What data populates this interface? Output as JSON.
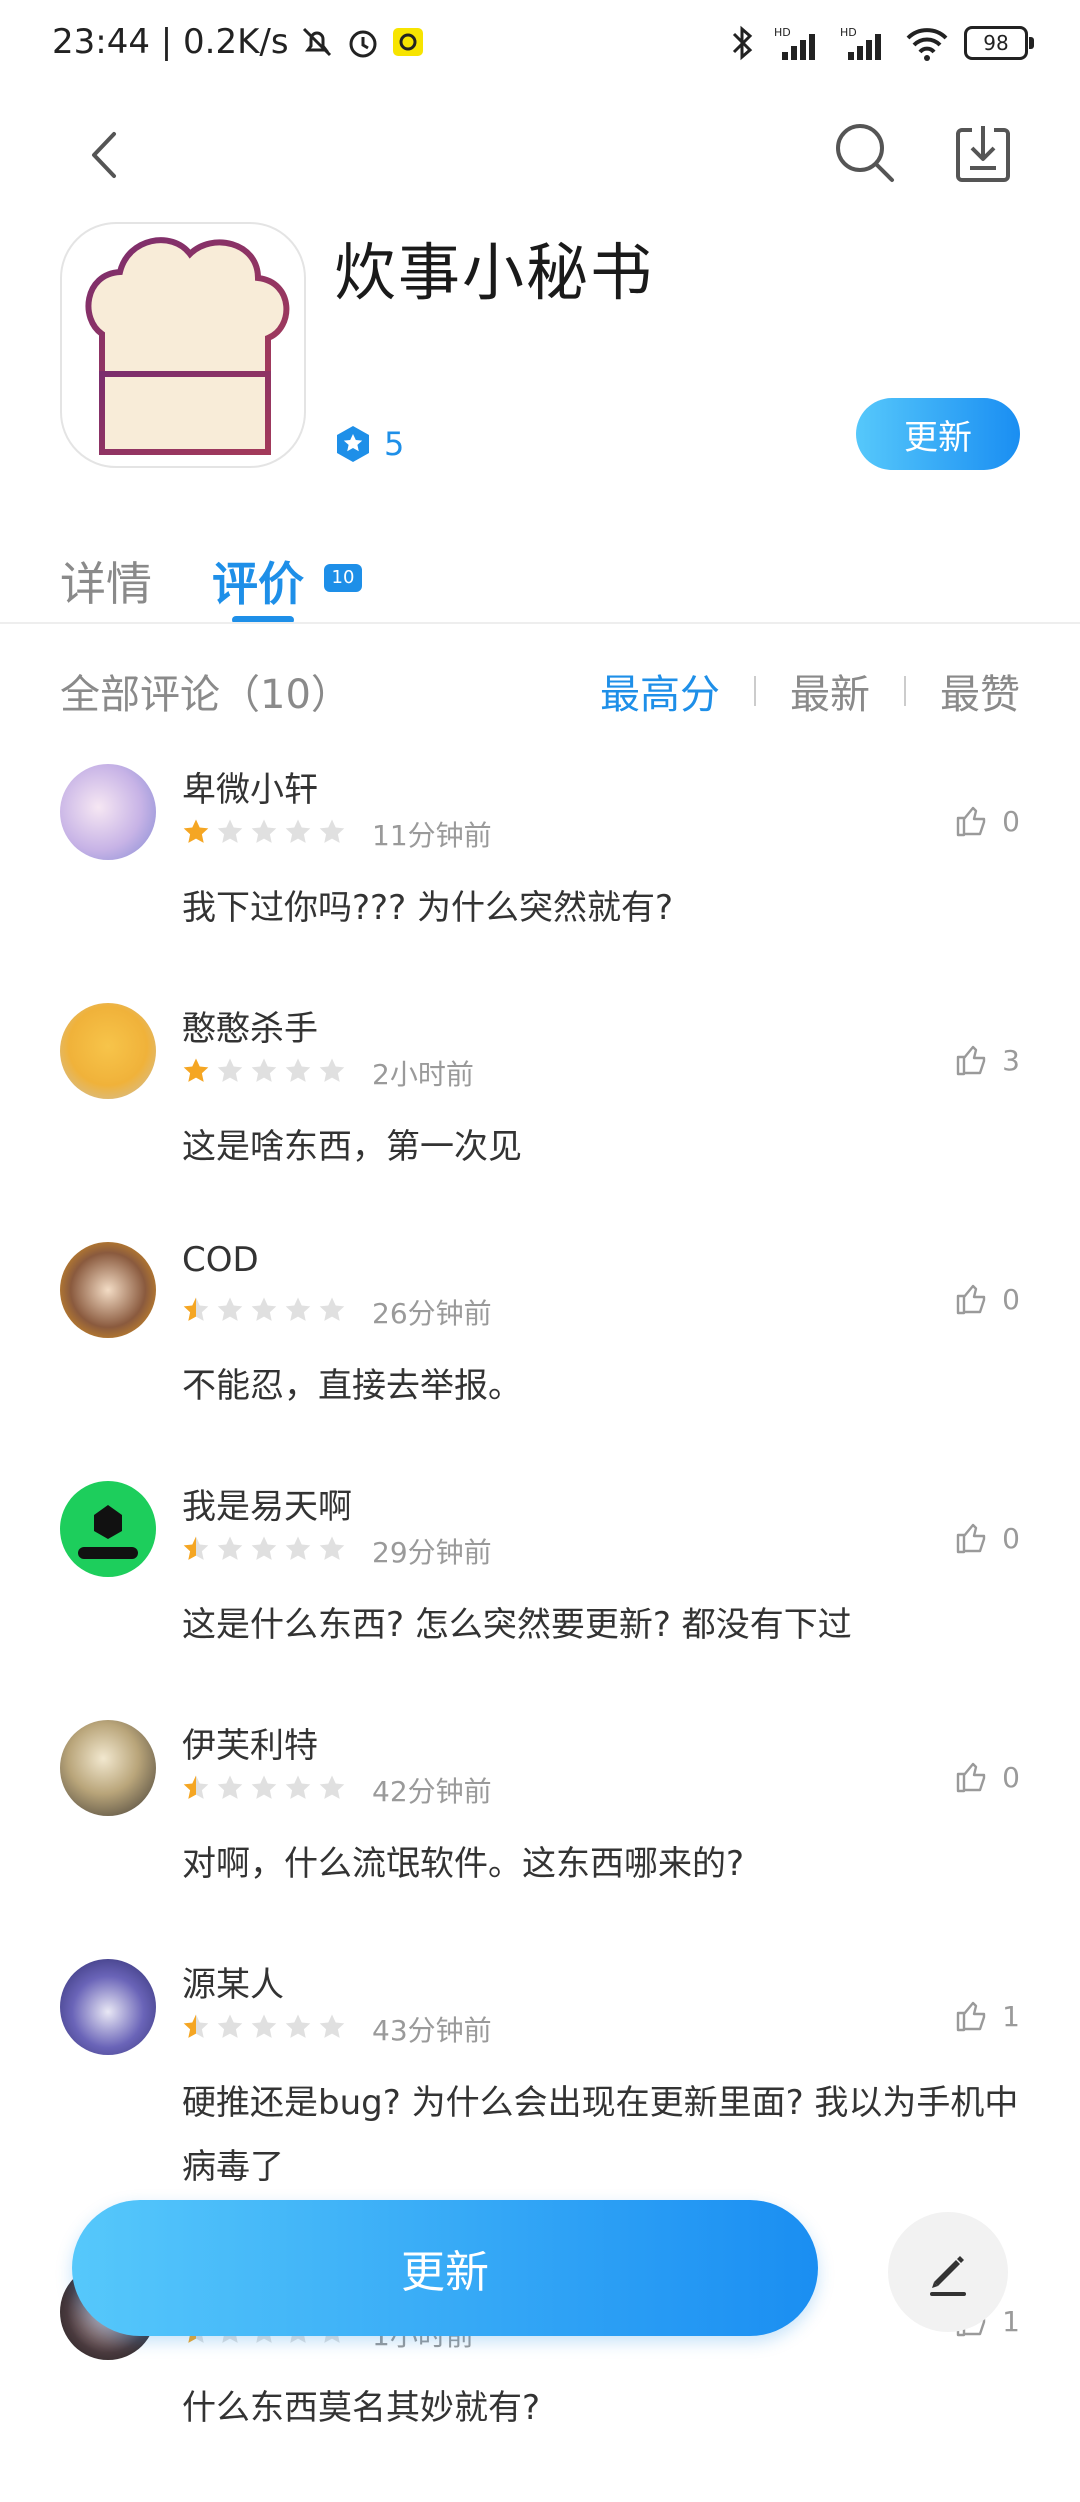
{
  "status_bar": {
    "time_speed": "23:44 | 0.2K/s",
    "battery": "98",
    "icons": [
      "mute-bell-icon",
      "alarm-icon",
      "app-notification-icon",
      "bluetooth-icon",
      "signal-hd-icon",
      "signal-hd-icon",
      "wifi-icon",
      "battery-icon"
    ]
  },
  "header": {
    "app_name": "炊事小秘书",
    "rating": "5",
    "update_label": "更新"
  },
  "tabs": {
    "details": "详情",
    "reviews": "评价",
    "reviews_count": "10"
  },
  "filter": {
    "title": "全部评论（10）",
    "options": [
      "最高分",
      "最新",
      "最赞"
    ]
  },
  "reviews": [
    {
      "name": "卑微小轩",
      "stars": 1,
      "time": "11分钟前",
      "likes": "0",
      "text": "我下过你吗??? 为什么突然就有?"
    },
    {
      "name": "憨憨杀手",
      "stars": 1,
      "time": "2小时前",
      "likes": "3",
      "text": "这是啥东西，第一次见"
    },
    {
      "name": "COD",
      "stars": 0.5,
      "time": "26分钟前",
      "likes": "0",
      "text": "不能忍，直接去举报。"
    },
    {
      "name": "我是易天啊",
      "stars": 0.5,
      "time": "29分钟前",
      "likes": "0",
      "text": "这是什么东西? 怎么突然要更新? 都没有下过"
    },
    {
      "name": "伊芙利特",
      "stars": 0.5,
      "time": "42分钟前",
      "likes": "0",
      "text": "对啊，什么流氓软件。这东西哪来的?"
    },
    {
      "name": "源某人",
      "stars": 0.5,
      "time": "43分钟前",
      "likes": "1",
      "text": "硬推还是bug? 为什么会出现在更新里面? 我以为手机中病毒了"
    },
    {
      "name": "",
      "stars": 0.5,
      "time": "1小时前",
      "likes": "1",
      "text": "什么东西莫名其妙就有?"
    }
  ],
  "bottom": {
    "update_label": "更新"
  },
  "colors": {
    "accent": "#1e8fe8",
    "star_filled": "#f5a623",
    "star_empty": "#e0e0e0"
  }
}
